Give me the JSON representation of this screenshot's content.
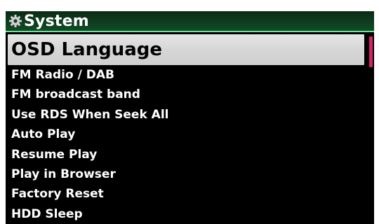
{
  "header": {
    "icon": "gear-icon",
    "title": "System",
    "accent_color": "#6fe39a"
  },
  "menu": {
    "items": [
      {
        "label": "OSD Language",
        "selected": true
      },
      {
        "label": "FM Radio / DAB",
        "selected": false
      },
      {
        "label": "FM broadcast band",
        "selected": false
      },
      {
        "label": "Use RDS When Seek All",
        "selected": false
      },
      {
        "label": "Auto Play",
        "selected": false
      },
      {
        "label": "Resume Play",
        "selected": false
      },
      {
        "label": "Play in Browser",
        "selected": false
      },
      {
        "label": "Factory Reset",
        "selected": false
      },
      {
        "label": "HDD Sleep",
        "selected": false
      }
    ],
    "selection_color": "#d8d8d8"
  },
  "scrollbar": {
    "color": "#d4226b",
    "position": "top"
  }
}
